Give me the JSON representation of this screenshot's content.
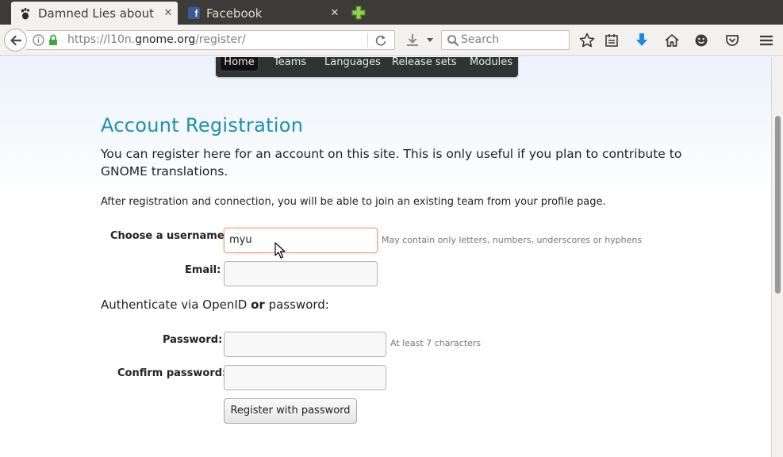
{
  "browser": {
    "tabs": [
      {
        "title": "Damned Lies about ...",
        "icon": "gnome-foot-icon",
        "active": true
      },
      {
        "title": "Facebook",
        "icon": "facebook-icon",
        "active": false
      }
    ],
    "url": {
      "prefix": "https://l10n.",
      "host": "gnome.org",
      "path": "/register/"
    },
    "search_placeholder": "Search"
  },
  "site_nav": [
    "Home",
    "Teams",
    "Languages",
    "Release sets",
    "Modules"
  ],
  "page": {
    "title": "Account Registration",
    "intro": "You can register here for an account on this site. This is only useful if you plan to contribute to GNOME translations.",
    "note": "After registration and connection, you will be able to join an existing team from your profile page.",
    "auth_prefix": "Authenticate via OpenID",
    "auth_or": "or",
    "auth_suffix": "password:"
  },
  "form": {
    "username_label": "Choose a username:",
    "username_value": "myu",
    "username_hint": "May contain only letters, numbers, underscores or hyphens",
    "email_label": "Email:",
    "email_value": "",
    "password_label": "Password:",
    "password_hint": "At least 7 characters",
    "confirm_label": "Confirm password:",
    "submit_label": "Register with password"
  },
  "colors": {
    "accent": "#1c8fb4",
    "tabstrip": "#3c3b37",
    "sitenav": "#2e3436"
  }
}
